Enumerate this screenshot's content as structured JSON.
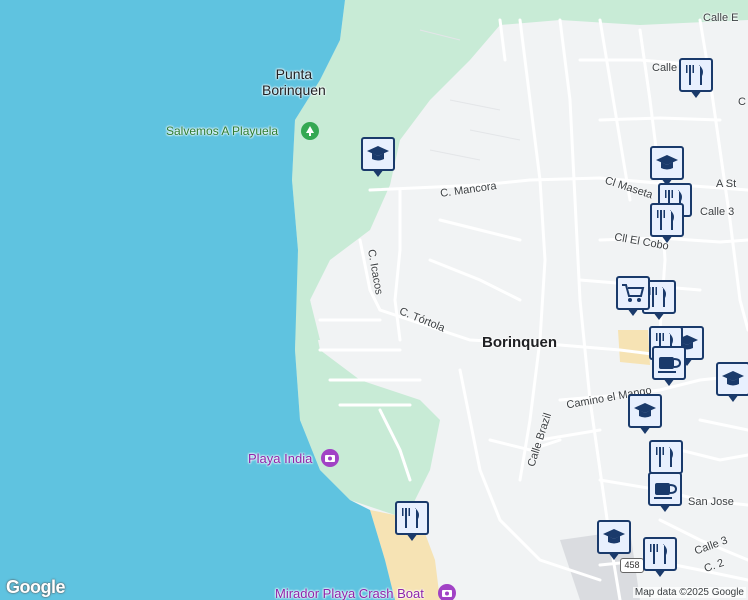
{
  "map": {
    "place_labels": {
      "punta_borinquen": "Punta\nBorinquen",
      "borinquen": "Borinquen"
    },
    "pois": {
      "salvemos": "Salvemos A Playuela",
      "playa_india": "Playa India",
      "mirador": "Mirador Playa Crash Boat"
    },
    "streets": {
      "calle_e": "Calle E",
      "calle_top": "Calle",
      "c_mancora": "C. Mancora",
      "cl_maseta": "Cl Maseta",
      "a_st": "A St",
      "calle_3a": "Calle 3",
      "cll_el_cobo": "Cll El Cobo",
      "c_icacos": "C. Icacos",
      "c_tortola": "C. Tórtola",
      "camino_el_mango": "Camino el Mango",
      "calle_brazil": "Calle Brazil",
      "san_jose": "San Jose",
      "calle_3b": "Calle 3",
      "c_2": "C. 2",
      "edge_c": "C"
    },
    "route_shield": "458",
    "attribution": "Map data ©2025 Google",
    "logo": "Google",
    "colors": {
      "water": "#5fc3e0",
      "park": "#c8ebd6",
      "land": "#f1f3f4",
      "beach": "#f6e3b4",
      "road": "#ffffff",
      "marker_border": "#1a3a6b"
    }
  }
}
